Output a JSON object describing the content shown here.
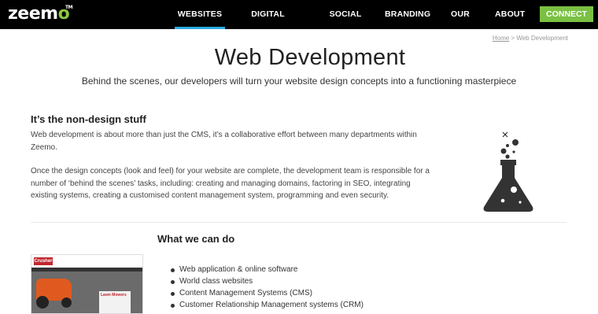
{
  "nav": {
    "logo_part1": "zeem",
    "logo_part2": "o",
    "logo_tm": "TM",
    "items": [
      {
        "label": "WEBSITES",
        "active": true
      },
      {
        "label": "DIGITAL MARKETING"
      },
      {
        "label": "SOCIAL MEDIA"
      },
      {
        "label": "BRANDING"
      },
      {
        "label": "OUR WORK"
      },
      {
        "label": "ABOUT"
      }
    ],
    "connect_label": "CONNECT"
  },
  "breadcrumb": {
    "home": "Home",
    "separator": ">",
    "current": "Web Development"
  },
  "hero": {
    "title": "Web Development",
    "subtitle": "Behind the scenes, our developers will turn your website design concepts into a functioning masterpiece"
  },
  "section_non_design": {
    "heading": "It’s the non-design stuff",
    "para1_lines": [
      "Web development is about more than just the CMS, it’s a collaborative effort between many departments within",
      "Zeemo."
    ],
    "para2_lines": [
      "Once the design concepts (look and feel) for your website are complete, the development team is responsible for a",
      "number of ‘behind the scenes’ tasks, including: creating and managing domains, factoring in SEO, integrating",
      "existing systems, creating a customised content management system, programming and even security."
    ],
    "icon": "flask-icon"
  },
  "section_what_we_do": {
    "heading": "What we can do",
    "items": [
      "Web application & online software",
      "World class websites",
      "Content Management Systems (CMS)",
      "Customer Relationship Management systems (CRM)"
    ],
    "thumbnail_logo": "Crusher",
    "thumbnail_label": "Lawn Mowers"
  },
  "colors": {
    "nav_bg": "#000000",
    "accent_green": "#7ac143",
    "active_underline": "#29abe2"
  }
}
